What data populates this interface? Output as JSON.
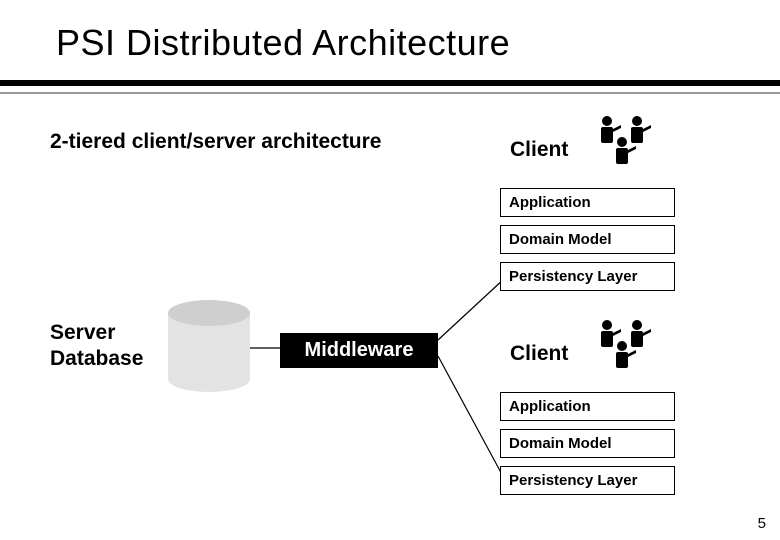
{
  "title": "PSI Distributed Architecture",
  "subtitle": "2-tiered client/server architecture",
  "serverLabel": "Server\nDatabase",
  "middleware": "Middleware",
  "clients": [
    {
      "label": "Client",
      "layers": [
        "Application",
        "Domain Model",
        "Persistency Layer"
      ]
    },
    {
      "label": "Client",
      "layers": [
        "Application",
        "Domain Model",
        "Persistency Layer"
      ]
    }
  ],
  "pageNumber": "5",
  "footerMeta": ""
}
